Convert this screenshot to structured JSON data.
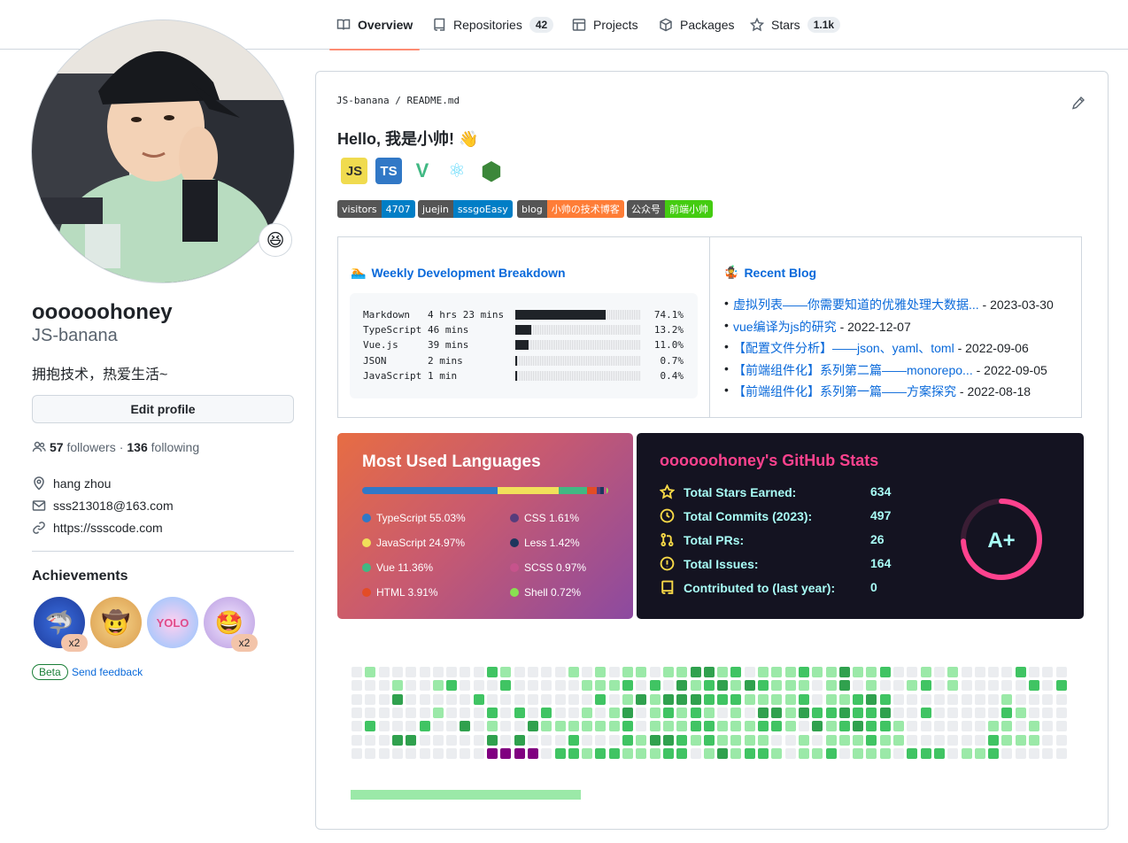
{
  "nav": {
    "tabs": [
      {
        "label": "Overview",
        "icon": "book-icon",
        "active": true
      },
      {
        "label": "Repositories",
        "icon": "repo-icon",
        "count": "42"
      },
      {
        "label": "Projects",
        "icon": "table-icon"
      },
      {
        "label": "Packages",
        "icon": "package-icon"
      },
      {
        "label": "Stars",
        "icon": "star-icon",
        "count": "1.1k"
      }
    ]
  },
  "profile": {
    "status_emoji": "😆",
    "name": "oooooohoney",
    "login": "JS-banana",
    "bio": "拥抱技术，热爱生活~",
    "edit_label": "Edit profile",
    "followers_count": "57",
    "followers_label": "followers",
    "separator": "·",
    "following_count": "136",
    "following_label": "following",
    "location": "hang zhou",
    "email": "sss213018@163.com",
    "website": "https://ssscode.com",
    "achievements_title": "Achievements",
    "achievements": [
      {
        "name": "shark-icon",
        "glyph": "🦈",
        "count": "x2"
      },
      {
        "name": "cowboy-icon",
        "glyph": "🤠",
        "count": ""
      },
      {
        "name": "yolo-icon",
        "glyph": "YOLO",
        "count": ""
      },
      {
        "name": "starstruck-icon",
        "glyph": "🤩",
        "count": "x2"
      }
    ],
    "beta_label": "Beta",
    "feedback_label": "Send feedback"
  },
  "readme": {
    "owner": "JS-banana",
    "sep": "/",
    "file": "README.md",
    "hello": "Hello, 我是小帅! 👋",
    "tech_icons": [
      {
        "label": "JS",
        "name": "javascript-icon",
        "bg": "#f0db4f",
        "fg": "#323330"
      },
      {
        "label": "TS",
        "name": "typescript-icon",
        "bg": "#3178c6",
        "fg": "#ffffff"
      },
      {
        "label": "V",
        "name": "vue-icon",
        "bg": "#ffffff",
        "fg": "#41b883"
      },
      {
        "label": "⚛",
        "name": "react-icon",
        "bg": "#ffffff",
        "fg": "#61dafb"
      },
      {
        "label": "⬢",
        "name": "node-icon",
        "bg": "#ffffff",
        "fg": "#3c873a"
      }
    ],
    "shields": [
      {
        "left": "visitors",
        "right": "4707",
        "color": "#007ec6"
      },
      {
        "left": "juejin",
        "right": "sssgoEasy",
        "color": "#007ec6"
      },
      {
        "left": "blog",
        "right": "小帅の技术博客",
        "color": "#fe7d37"
      },
      {
        "left": "公众号",
        "right": "前端小帅",
        "color": "#4c1"
      }
    ],
    "weekly_title": "Weekly Development Breakdown",
    "weekly_emoji": "🏊",
    "weekly": [
      {
        "lang": "Markdown",
        "time": "4 hrs 23 mins",
        "pct": "74.1%",
        "value": 74.1
      },
      {
        "lang": "TypeScript",
        "time": "46 mins",
        "pct": "13.2%",
        "value": 13.2
      },
      {
        "lang": "Vue.js",
        "time": "39 mins",
        "pct": "11.0%",
        "value": 11.0
      },
      {
        "lang": "JSON",
        "time": "2 mins",
        "pct": "0.7%",
        "value": 0.7
      },
      {
        "lang": "JavaScript",
        "time": "1 min",
        "pct": "0.4%",
        "value": 0.4
      }
    ],
    "blog_title": "Recent Blog",
    "blog_emoji": "🤹",
    "blog": [
      {
        "title": "虚拟列表——你需要知道的优雅处理大数据...",
        "date": " - 2023-03-30"
      },
      {
        "title": "vue编译为js的研究",
        "date": " - 2022-12-07"
      },
      {
        "title": "【配置文件分析】——json、yaml、toml",
        "date": " - 2022-09-06"
      },
      {
        "title": "【前端组件化】系列第二篇——monorepo...",
        "date": " - 2022-09-05"
      },
      {
        "title": "【前端组件化】系列第一篇——方案探究",
        "date": " - 2022-08-18"
      }
    ]
  },
  "languages": {
    "title": "Most Used Languages",
    "items": [
      {
        "label": "TypeScript 55.03%",
        "value": 55.03,
        "color": "#3178c6"
      },
      {
        "label": "CSS 1.61%",
        "value": 1.61,
        "color": "#563d7c"
      },
      {
        "label": "JavaScript 24.97%",
        "value": 24.97,
        "color": "#f1e05a"
      },
      {
        "label": "Less 1.42%",
        "value": 1.42,
        "color": "#1d365d"
      },
      {
        "label": "Vue 11.36%",
        "value": 11.36,
        "color": "#41b883"
      },
      {
        "label": "SCSS 0.97%",
        "value": 0.97,
        "color": "#c6538c"
      },
      {
        "label": "HTML 3.91%",
        "value": 3.91,
        "color": "#e34c26"
      },
      {
        "label": "Shell 0.72%",
        "value": 0.72,
        "color": "#89e051"
      }
    ]
  },
  "stats": {
    "title": "oooooohoney's GitHub Stats",
    "rank": "A+",
    "rows": [
      {
        "label": "Total Stars Earned:",
        "value": "634",
        "icon": "star-icon"
      },
      {
        "label": "Total Commits (2023):",
        "value": "497",
        "icon": "history-icon"
      },
      {
        "label": "Total PRs:",
        "value": "26",
        "icon": "pr-icon"
      },
      {
        "label": "Total Issues:",
        "value": "164",
        "icon": "issue-icon"
      },
      {
        "label": "Contributed to (last year):",
        "value": "0",
        "icon": "repo-icon"
      }
    ],
    "colors": {
      "title": "#fe428e",
      "text": "#a9fef7",
      "icon": "#f8d847",
      "bg": "#141321"
    }
  }
}
